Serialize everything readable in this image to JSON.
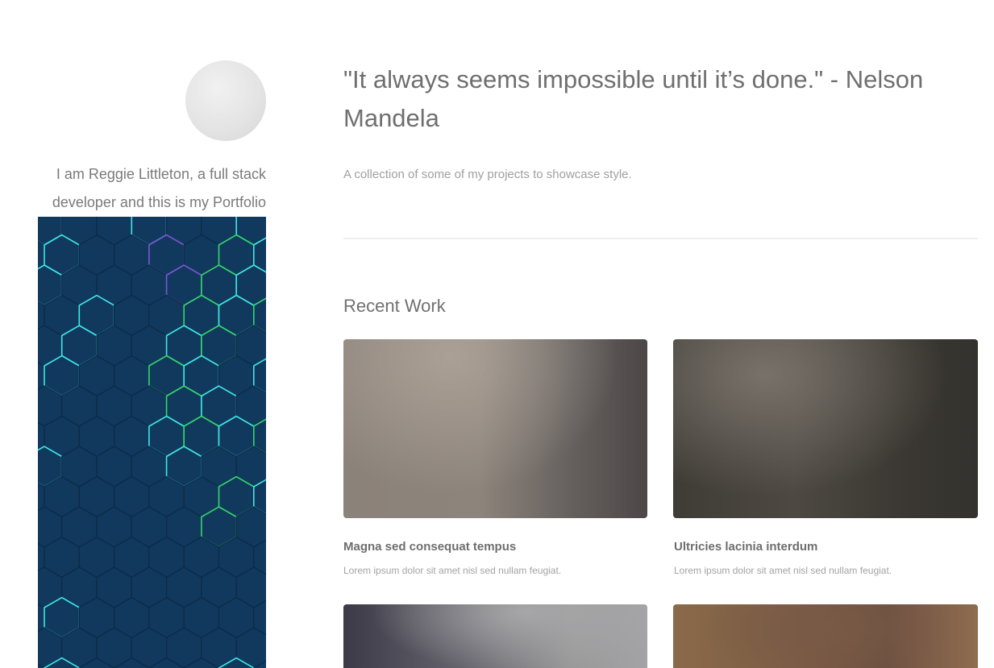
{
  "sidebar": {
    "avatar_icon": "avatar-placeholder",
    "bio": "I am Reggie Littleton, a full stack developer and this is my Portfolio",
    "banner_image": "hexagon-pattern"
  },
  "header": {
    "quote": "\"It always seems impossible until it’s done.\" - Nelson Mandela",
    "subtitle": "A collection of some of my projects to showcase style."
  },
  "recent_work": {
    "title": "Recent Work",
    "items": [
      {
        "title": "Magna sed consequat tempus",
        "description": "Lorem ipsum dolor sit amet nisl sed nullam feugiat."
      },
      {
        "title": "Ultricies lacinia interdum",
        "description": "Lorem ipsum dolor sit amet nisl sed nullam feugiat."
      },
      {
        "title": "",
        "description": ""
      },
      {
        "title": "",
        "description": ""
      }
    ]
  },
  "colors": {
    "text": "#6f6f6f",
    "muted": "#a0a0a0",
    "hex_panel_bg": "#10385b",
    "hex_glow_cyan": "#3fe6e6",
    "hex_glow_green": "#34d66b",
    "hex_glow_purple": "#7b55d6"
  }
}
